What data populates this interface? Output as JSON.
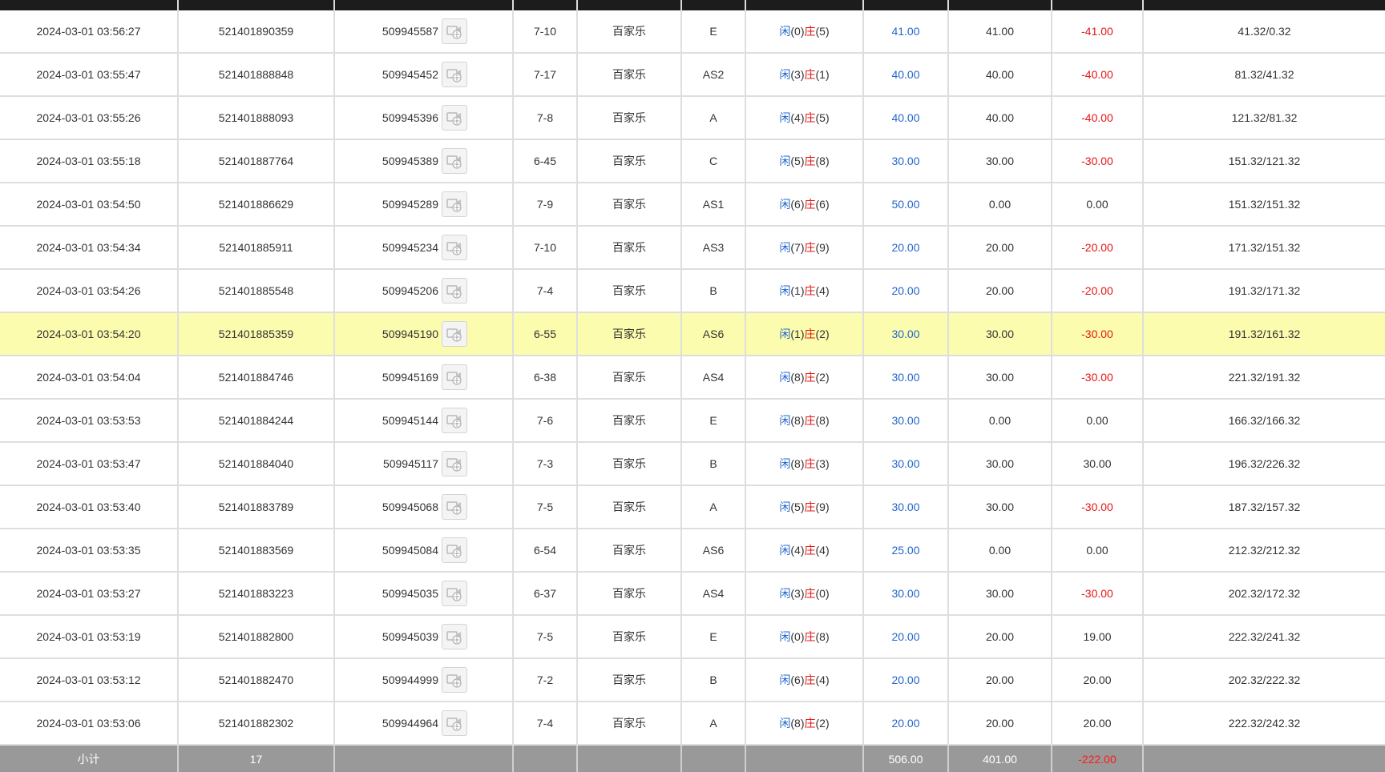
{
  "header": {
    "columns": [
      "",
      "",
      "",
      "",
      "",
      "",
      "",
      "",
      "",
      "",
      ""
    ]
  },
  "rows": [
    {
      "time": "2024-03-01 03:56:27",
      "bet_no": "521401890359",
      "round": "509945587",
      "table": "7-10",
      "game": "百家乐",
      "seat": "E",
      "player_label": "闲",
      "player_val": "(0)",
      "banker_label": "庄",
      "banker_val": "(5)",
      "bet": "41.00",
      "valid": "41.00",
      "winloss": "-41.00",
      "winloss_color": "red",
      "balance": "41.32/0.32",
      "highlight": false
    },
    {
      "time": "2024-03-01 03:55:47",
      "bet_no": "521401888848",
      "round": "509945452",
      "table": "7-17",
      "game": "百家乐",
      "seat": "AS2",
      "player_label": "闲",
      "player_val": "(3)",
      "banker_label": "庄",
      "banker_val": "(1)",
      "bet": "40.00",
      "valid": "40.00",
      "winloss": "-40.00",
      "winloss_color": "red",
      "balance": "81.32/41.32",
      "highlight": false
    },
    {
      "time": "2024-03-01 03:55:26",
      "bet_no": "521401888093",
      "round": "509945396",
      "table": "7-8",
      "game": "百家乐",
      "seat": "A",
      "player_label": "闲",
      "player_val": "(4)",
      "banker_label": "庄",
      "banker_val": "(5)",
      "bet": "40.00",
      "valid": "40.00",
      "winloss": "-40.00",
      "winloss_color": "red",
      "balance": "121.32/81.32",
      "highlight": false
    },
    {
      "time": "2024-03-01 03:55:18",
      "bet_no": "521401887764",
      "round": "509945389",
      "table": "6-45",
      "game": "百家乐",
      "seat": "C",
      "player_label": "闲",
      "player_val": "(5)",
      "banker_label": "庄",
      "banker_val": "(8)",
      "bet": "30.00",
      "valid": "30.00",
      "winloss": "-30.00",
      "winloss_color": "red",
      "balance": "151.32/121.32",
      "highlight": false
    },
    {
      "time": "2024-03-01 03:54:50",
      "bet_no": "521401886629",
      "round": "509945289",
      "table": "7-9",
      "game": "百家乐",
      "seat": "AS1",
      "player_label": "闲",
      "player_val": "(6)",
      "banker_label": "庄",
      "banker_val": "(6)",
      "bet": "50.00",
      "valid": "0.00",
      "winloss": "0.00",
      "winloss_color": "black",
      "balance": "151.32/151.32",
      "highlight": false
    },
    {
      "time": "2024-03-01 03:54:34",
      "bet_no": "521401885911",
      "round": "509945234",
      "table": "7-10",
      "game": "百家乐",
      "seat": "AS3",
      "player_label": "闲",
      "player_val": "(7)",
      "banker_label": "庄",
      "banker_val": "(9)",
      "bet": "20.00",
      "valid": "20.00",
      "winloss": "-20.00",
      "winloss_color": "red",
      "balance": "171.32/151.32",
      "highlight": false
    },
    {
      "time": "2024-03-01 03:54:26",
      "bet_no": "521401885548",
      "round": "509945206",
      "table": "7-4",
      "game": "百家乐",
      "seat": "B",
      "player_label": "闲",
      "player_val": "(1)",
      "banker_label": "庄",
      "banker_val": "(4)",
      "bet": "20.00",
      "valid": "20.00",
      "winloss": "-20.00",
      "winloss_color": "red",
      "balance": "191.32/171.32",
      "highlight": false
    },
    {
      "time": "2024-03-01 03:54:20",
      "bet_no": "521401885359",
      "round": "509945190",
      "table": "6-55",
      "game": "百家乐",
      "seat": "AS6",
      "player_label": "闲",
      "player_val": "(1)",
      "banker_label": "庄",
      "banker_val": "(2)",
      "bet": "30.00",
      "valid": "30.00",
      "winloss": "-30.00",
      "winloss_color": "red",
      "balance": "191.32/161.32",
      "highlight": true
    },
    {
      "time": "2024-03-01 03:54:04",
      "bet_no": "521401884746",
      "round": "509945169",
      "table": "6-38",
      "game": "百家乐",
      "seat": "AS4",
      "player_label": "闲",
      "player_val": "(8)",
      "banker_label": "庄",
      "banker_val": "(2)",
      "bet": "30.00",
      "valid": "30.00",
      "winloss": "-30.00",
      "winloss_color": "red",
      "balance": "221.32/191.32",
      "highlight": false
    },
    {
      "time": "2024-03-01 03:53:53",
      "bet_no": "521401884244",
      "round": "509945144",
      "table": "7-6",
      "game": "百家乐",
      "seat": "E",
      "player_label": "闲",
      "player_val": "(8)",
      "banker_label": "庄",
      "banker_val": "(8)",
      "bet": "30.00",
      "valid": "0.00",
      "winloss": "0.00",
      "winloss_color": "black",
      "balance": "166.32/166.32",
      "highlight": false
    },
    {
      "time": "2024-03-01 03:53:47",
      "bet_no": "521401884040",
      "round": "509945117",
      "table": "7-3",
      "game": "百家乐",
      "seat": "B",
      "player_label": "闲",
      "player_val": "(8)",
      "banker_label": "庄",
      "banker_val": "(3)",
      "bet": "30.00",
      "valid": "30.00",
      "winloss": "30.00",
      "winloss_color": "black",
      "balance": "196.32/226.32",
      "highlight": false
    },
    {
      "time": "2024-03-01 03:53:40",
      "bet_no": "521401883789",
      "round": "509945068",
      "table": "7-5",
      "game": "百家乐",
      "seat": "A",
      "player_label": "闲",
      "player_val": "(5)",
      "banker_label": "庄",
      "banker_val": "(9)",
      "bet": "30.00",
      "valid": "30.00",
      "winloss": "-30.00",
      "winloss_color": "red",
      "balance": "187.32/157.32",
      "highlight": false
    },
    {
      "time": "2024-03-01 03:53:35",
      "bet_no": "521401883569",
      "round": "509945084",
      "table": "6-54",
      "game": "百家乐",
      "seat": "AS6",
      "player_label": "闲",
      "player_val": "(4)",
      "banker_label": "庄",
      "banker_val": "(4)",
      "bet": "25.00",
      "valid": "0.00",
      "winloss": "0.00",
      "winloss_color": "black",
      "balance": "212.32/212.32",
      "highlight": false
    },
    {
      "time": "2024-03-01 03:53:27",
      "bet_no": "521401883223",
      "round": "509945035",
      "table": "6-37",
      "game": "百家乐",
      "seat": "AS4",
      "player_label": "闲",
      "player_val": "(3)",
      "banker_label": "庄",
      "banker_val": "(0)",
      "bet": "30.00",
      "valid": "30.00",
      "winloss": "-30.00",
      "winloss_color": "red",
      "balance": "202.32/172.32",
      "highlight": false
    },
    {
      "time": "2024-03-01 03:53:19",
      "bet_no": "521401882800",
      "round": "509945039",
      "table": "7-5",
      "game": "百家乐",
      "seat": "E",
      "player_label": "闲",
      "player_val": "(0)",
      "banker_label": "庄",
      "banker_val": "(8)",
      "bet": "20.00",
      "valid": "20.00",
      "winloss": "19.00",
      "winloss_color": "black",
      "balance": "222.32/241.32",
      "highlight": false
    },
    {
      "time": "2024-03-01 03:53:12",
      "bet_no": "521401882470",
      "round": "509944999",
      "table": "7-2",
      "game": "百家乐",
      "seat": "B",
      "player_label": "闲",
      "player_val": "(6)",
      "banker_label": "庄",
      "banker_val": "(4)",
      "bet": "20.00",
      "valid": "20.00",
      "winloss": "20.00",
      "winloss_color": "black",
      "balance": "202.32/222.32",
      "highlight": false
    },
    {
      "time": "2024-03-01 03:53:06",
      "bet_no": "521401882302",
      "round": "509944964",
      "table": "7-4",
      "game": "百家乐",
      "seat": "A",
      "player_label": "闲",
      "player_val": "(8)",
      "banker_label": "庄",
      "banker_val": "(2)",
      "bet": "20.00",
      "valid": "20.00",
      "winloss": "20.00",
      "winloss_color": "black",
      "balance": "222.32/242.32",
      "highlight": false
    }
  ],
  "summary": {
    "label": "小计",
    "count": "17",
    "bet_total": "506.00",
    "valid_total": "401.00",
    "winloss_total": "-222.00"
  },
  "colors": {
    "header_bg": "#1c1c1c",
    "highlight_row": "#fcfcae",
    "blue_text": "#2266cc",
    "red_text": "#e51414",
    "summary_bg": "#999999"
  },
  "icons": {
    "replay": "video-replay-icon"
  }
}
